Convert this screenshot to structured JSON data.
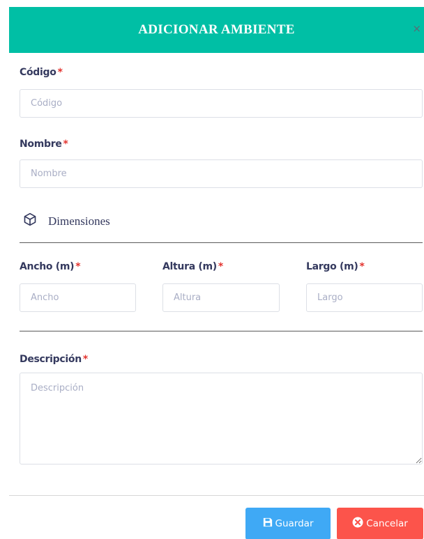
{
  "modal": {
    "title": "ADICIONAR AMBIENTE",
    "close": "×"
  },
  "fields": {
    "codigo": {
      "label": "Código",
      "required": "*",
      "placeholder": "Código",
      "value": ""
    },
    "nombre": {
      "label": "Nombre",
      "required": "*",
      "placeholder": "Nombre",
      "value": ""
    },
    "ancho": {
      "label": "Ancho (m)",
      "required": "*",
      "placeholder": "Ancho",
      "value": ""
    },
    "altura": {
      "label": "Altura (m)",
      "required": "*",
      "placeholder": "Altura",
      "value": ""
    },
    "largo": {
      "label": "Largo (m)",
      "required": "*",
      "placeholder": "Largo",
      "value": ""
    },
    "descripcion": {
      "label": "Descripción",
      "required": "*",
      "placeholder": "Descripción",
      "value": ""
    }
  },
  "section": {
    "label": "Dimensiones",
    "icon": "cube-icon"
  },
  "buttons": {
    "save": {
      "label": "Guardar",
      "icon": "save-icon",
      "color": "#3fa9f5"
    },
    "cancel": {
      "label": "Cancelar",
      "icon": "times-circle-icon",
      "color": "#fc544b"
    }
  },
  "colors": {
    "header": "#00bfa5",
    "required": "#e3342f"
  }
}
